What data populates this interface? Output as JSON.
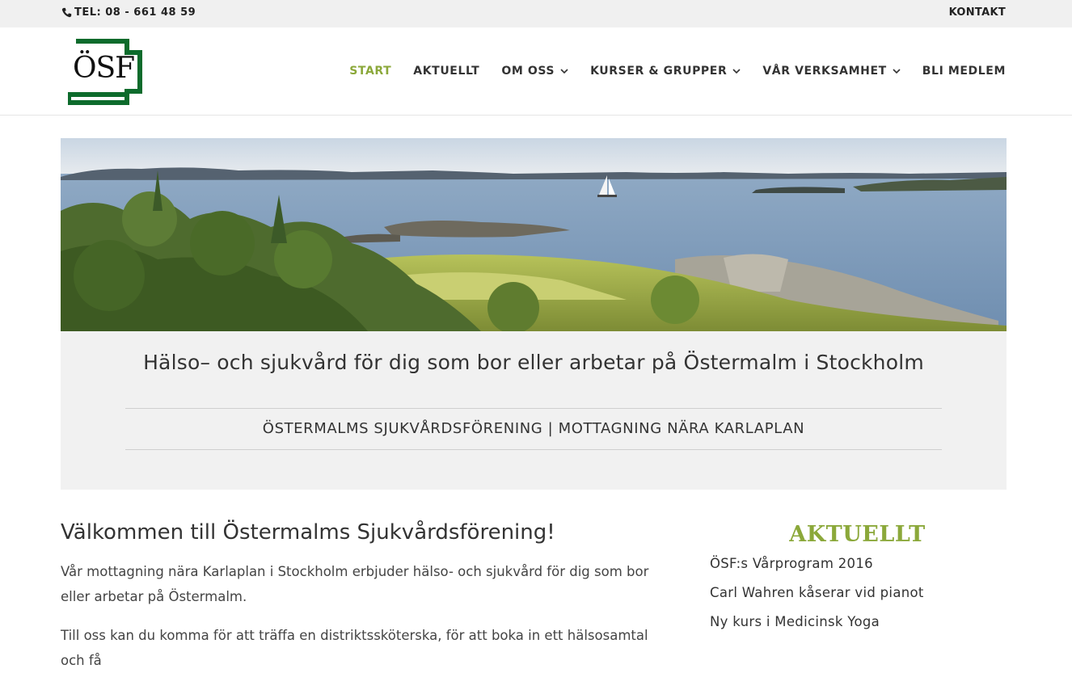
{
  "topbar": {
    "phone": "TEL: 08 - 661 48 59",
    "contact": "KONTAKT"
  },
  "logo": {
    "text": "ÖSF",
    "color": "#0d6b2c"
  },
  "nav": {
    "active_color": "#8ba83a",
    "items": [
      {
        "label": "START",
        "active": true,
        "dropdown": false
      },
      {
        "label": "AKTUELLT",
        "active": false,
        "dropdown": false
      },
      {
        "label": "OM OSS",
        "active": false,
        "dropdown": true
      },
      {
        "label": "KURSER & GRUPPER",
        "active": false,
        "dropdown": true
      },
      {
        "label": "VÅR VERKSAMHET",
        "active": false,
        "dropdown": true
      },
      {
        "label": "BLI MEDLEM",
        "active": false,
        "dropdown": false
      }
    ]
  },
  "hero": {
    "title": "Hälso– och sjukvård för dig som bor eller arbetar på Östermalm i Stockholm",
    "subtitle": "ÖSTERMALMS SJUKVÅRDSFÖRENING | MOTTAGNING NÄRA KARLAPLAN"
  },
  "main": {
    "title": "Välkommen till Östermalms Sjukvårdsförening!",
    "paragraphs": [
      "Vår mottagning nära Karlaplan i Stockholm erbjuder hälso- och sjukvård för dig som bor eller arbetar på Östermalm.",
      "Till oss kan du komma för att träffa en distriktssköterska, för att boka in ett hälsosamtal och få"
    ]
  },
  "sidebar": {
    "title": "AKTUELLT",
    "links": [
      "ÖSF:s Vårprogram 2016",
      "Carl Wahren kåserar vid pianot",
      "Ny kurs i Medicinsk Yoga"
    ]
  }
}
